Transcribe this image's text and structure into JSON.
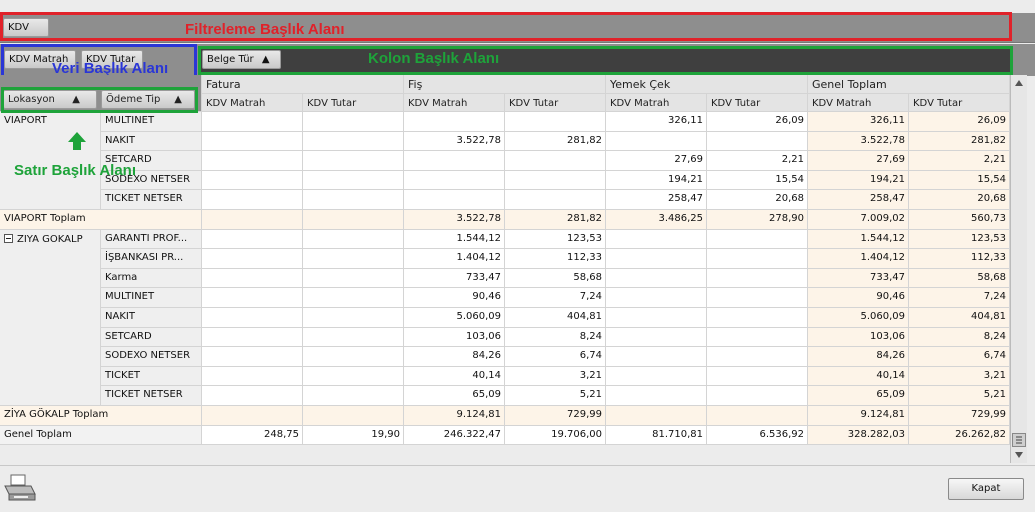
{
  "filter_area": {
    "chip": "KDV",
    "annotation": "Filtreleme Başlık Alanı",
    "annotation_color": "#e0222a"
  },
  "data_area": {
    "chips": [
      "KDV Matrah",
      "KDV Tutar"
    ],
    "annotation": "Veri Başlık Alanı",
    "annotation_color": "#2a36d6"
  },
  "column_area": {
    "chip": "Belge Tür",
    "annotation": "Kolon Başlık Alanı",
    "annotation_color": "#1ea33a"
  },
  "row_area": {
    "chips": [
      "Lokasyon",
      "Ödeme Tip"
    ],
    "annotation": "Satır Başlık Alanı",
    "annotation_color": "#1ea33a"
  },
  "columns": {
    "groups": [
      "Fatura",
      "Fiş",
      "Yemek Çek",
      "Genel Toplam"
    ],
    "sub": [
      "KDV Matrah",
      "KDV Tutar"
    ]
  },
  "rows": [
    {
      "loc": "VIAPORT",
      "pay": "MULTINET",
      "v": [
        "",
        "",
        "",
        "",
        "326,11",
        "26,09",
        "326,11",
        "26,09"
      ]
    },
    {
      "loc": "",
      "pay": "NAKIT",
      "v": [
        "",
        "",
        "3.522,78",
        "281,82",
        "",
        "",
        "3.522,78",
        "281,82"
      ]
    },
    {
      "loc": "",
      "pay": "SETCARD",
      "v": [
        "",
        "",
        "",
        "",
        "27,69",
        "2,21",
        "27,69",
        "2,21"
      ]
    },
    {
      "loc": "",
      "pay": "SODEXO NETSER",
      "v": [
        "",
        "",
        "",
        "",
        "194,21",
        "15,54",
        "194,21",
        "15,54"
      ]
    },
    {
      "loc": "",
      "pay": "TICKET NETSER",
      "v": [
        "",
        "",
        "",
        "",
        "258,47",
        "20,68",
        "258,47",
        "20,68"
      ]
    },
    {
      "total": "VIAPORT Toplam",
      "v": [
        "",
        "",
        "3.522,78",
        "281,82",
        "3.486,25",
        "278,90",
        "7.009,02",
        "560,73"
      ]
    },
    {
      "loc": "ZIYA GOKALP",
      "pay": "GARANTI PROF...",
      "v": [
        "",
        "",
        "1.544,12",
        "123,53",
        "",
        "",
        "1.544,12",
        "123,53"
      ]
    },
    {
      "loc": "",
      "pay": "İŞBANKASI PR...",
      "v": [
        "",
        "",
        "1.404,12",
        "112,33",
        "",
        "",
        "1.404,12",
        "112,33"
      ]
    },
    {
      "loc": "",
      "pay": "Karma",
      "v": [
        "",
        "",
        "733,47",
        "58,68",
        "",
        "",
        "733,47",
        "58,68"
      ]
    },
    {
      "loc": "",
      "pay": "MULTINET",
      "v": [
        "",
        "",
        "90,46",
        "7,24",
        "",
        "",
        "90,46",
        "7,24"
      ]
    },
    {
      "loc": "",
      "pay": "NAKIT",
      "v": [
        "",
        "",
        "5.060,09",
        "404,81",
        "",
        "",
        "5.060,09",
        "404,81"
      ]
    },
    {
      "loc": "",
      "pay": "SETCARD",
      "v": [
        "",
        "",
        "103,06",
        "8,24",
        "",
        "",
        "103,06",
        "8,24"
      ]
    },
    {
      "loc": "",
      "pay": "SODEXO NETSER",
      "v": [
        "",
        "",
        "84,26",
        "6,74",
        "",
        "",
        "84,26",
        "6,74"
      ]
    },
    {
      "loc": "",
      "pay": "TICKET",
      "v": [
        "",
        "",
        "40,14",
        "3,21",
        "",
        "",
        "40,14",
        "3,21"
      ]
    },
    {
      "loc": "",
      "pay": "TICKET NETSER",
      "v": [
        "",
        "",
        "65,09",
        "5,21",
        "",
        "",
        "65,09",
        "5,21"
      ]
    },
    {
      "total": "ZİYA GÖKALP Toplam",
      "v": [
        "",
        "",
        "9.124,81",
        "729,99",
        "",
        "",
        "9.124,81",
        "729,99"
      ]
    },
    {
      "grand": "Genel Toplam",
      "v": [
        "248,75",
        "19,90",
        "246.322,47",
        "19.706,00",
        "81.710,81",
        "6.536,92",
        "328.282,03",
        "26.262,82"
      ]
    }
  ],
  "close_button": "Kapat"
}
